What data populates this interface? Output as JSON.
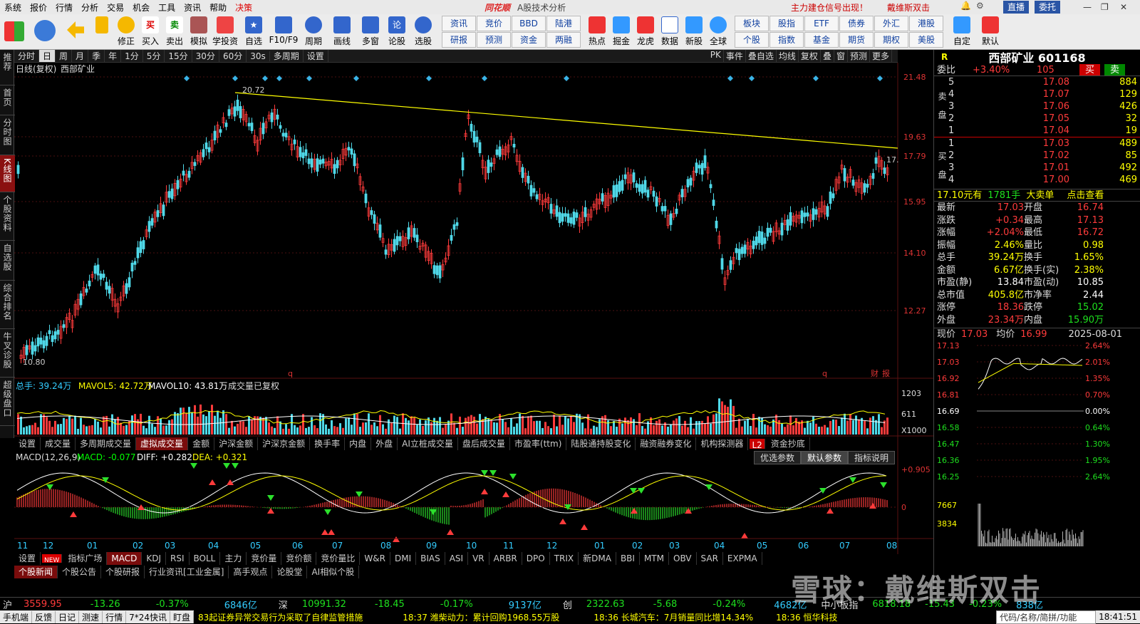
{
  "menu": {
    "items": [
      "系统",
      "报价",
      "行情",
      "分析",
      "交易",
      "机会",
      "工具",
      "资讯",
      "帮助",
      "决策"
    ],
    "brand": "同花顺",
    "subtitle": "A股技术分析",
    "notice1": "主力建仓信号出现！",
    "notice2": "戴维斯双击",
    "btn1": "直播",
    "btn2": "委托"
  },
  "toolbar": {
    "buttons": [
      "修正",
      "买入",
      "卖出",
      "模拟",
      "学投资",
      "自选",
      "F10/F9",
      "周期",
      "画线",
      "多窗",
      "论股",
      "选股"
    ],
    "grid1": [
      "资讯",
      "竞价",
      "BBD",
      "陆港",
      "研报",
      "预测",
      "资金",
      "两融"
    ],
    "buttons2": [
      "热点",
      "掘金",
      "龙虎",
      "数据",
      "新股",
      "全球"
    ],
    "grid2": [
      "板块",
      "股指",
      "ETF",
      "债券",
      "外汇",
      "港股",
      "个股",
      "指数",
      "基金",
      "期货",
      "期权",
      "美股"
    ],
    "buttons3": [
      "自定",
      "默认"
    ]
  },
  "leftnav": [
    "推荐",
    "首页",
    "分时图",
    "K线图",
    "个股资料",
    "自选股",
    "综合排名",
    "牛叉诊股",
    "超级盘口"
  ],
  "periods": [
    "分时",
    "日",
    "周",
    "月",
    "季",
    "年",
    "1分",
    "5分",
    "15分",
    "30分",
    "60分",
    "30s",
    "多周期",
    "设置"
  ],
  "period_selected": "日",
  "rightbar": [
    "PK",
    "事件",
    "叠自选",
    "均线",
    "复权",
    "叠",
    "窗",
    "预测",
    "更多"
  ],
  "kline": {
    "label": "日线(复权)",
    "stock": "西部矿业",
    "high_label": "20.72",
    "low_label": "10.80",
    "last_label": "17."
  },
  "price_ticks": [
    "21.48",
    "19.63",
    "17.79",
    "15.95",
    "14.10",
    "12.27"
  ],
  "volume": {
    "label_total": "总手: 39.24万",
    "label_mavol5": "MAVOL5: 42.72万",
    "label_mavol10": "MAVOL10: 43.81万",
    "label_note": "成交量已复权",
    "ticks": [
      "1203",
      "611",
      "X1000"
    ]
  },
  "vol_tabs": [
    "设置",
    "成交量",
    "多周期成交量",
    "虚拟成交量",
    "金额",
    "沪深金额",
    "沪深京金额",
    "换手率",
    "内盘",
    "外盘",
    "AI立桩成交量",
    "盘后成交量",
    "市盈率(ttm)",
    "陆股通持股变化",
    "融资融券变化",
    "机构探测器",
    "L2",
    "资金抄底"
  ],
  "macd": {
    "label": "MACD(12,26,9)",
    "macd": "MACD: -0.077",
    "diff": "DIFF: +0.282",
    "dea": "DEA: +0.321",
    "ticks": [
      "+0.905",
      "0"
    ],
    "buttons": [
      "优选参数",
      "默认参数",
      "指标说明"
    ]
  },
  "xaxis": [
    "11",
    "12",
    "01",
    "02",
    "03",
    "04",
    "05",
    "06",
    "07",
    "08",
    "09",
    "10",
    "11",
    "12",
    "01",
    "02",
    "03",
    "04",
    "05",
    "06",
    "07",
    "08"
  ],
  "ind_tabs": [
    "设置",
    "NEW",
    "指标广场",
    "MACD",
    "KDJ",
    "RSI",
    "BOLL",
    "主力",
    "竞价量",
    "竞价额",
    "竞价量比",
    "W&R",
    "DMI",
    "BIAS",
    "ASI",
    "VR",
    "ARBR",
    "DPO",
    "TRIX",
    "新DMA",
    "BBI",
    "MTM",
    "OBV",
    "SAR",
    "EXPMA"
  ],
  "news_tabs": [
    "个股新闻",
    "个股公告",
    "个股研报",
    "行业资讯[工业金属]",
    "高手观点",
    "论股堂",
    "AI相似个股"
  ],
  "quote": {
    "title": "西部矿业 601168",
    "r": "R",
    "weibi_label": "委比",
    "weibi": "+3.40%",
    "weicha": "105",
    "buy": "买",
    "sell": "卖",
    "sell_label": "卖盘",
    "buy_label": "买盘",
    "asks": [
      [
        "5",
        "17.08",
        "884"
      ],
      [
        "4",
        "17.07",
        "129"
      ],
      [
        "3",
        "17.06",
        "426"
      ],
      [
        "2",
        "17.05",
        "32"
      ],
      [
        "1",
        "17.04",
        "19"
      ]
    ],
    "bids": [
      [
        "1",
        "17.03",
        "489"
      ],
      [
        "2",
        "17.02",
        "85"
      ],
      [
        "3",
        "17.01",
        "492"
      ],
      [
        "4",
        "17.00",
        "469"
      ]
    ],
    "trade": "17.10元有",
    "trade_vol": "1781手",
    "trade_tag": "大卖单",
    "trade_more": "点击查看",
    "stats": [
      [
        "最新",
        "17.03",
        "开盘",
        "16.74"
      ],
      [
        "涨跌",
        "+0.34",
        "最高",
        "17.13"
      ],
      [
        "涨幅",
        "+2.04%",
        "最低",
        "16.72"
      ],
      [
        "振幅",
        "2.46%",
        "量比",
        "0.98"
      ],
      [
        "总手",
        "39.24万",
        "换手",
        "1.65%"
      ],
      [
        "金额",
        "6.67亿",
        "换手(实)",
        "2.38%"
      ],
      [
        "市盈(静)",
        "13.84",
        "市盈(动)",
        "10.85"
      ],
      [
        "总市值",
        "405.8亿",
        "市净率",
        "2.44"
      ],
      [
        "涨停",
        "18.36",
        "跌停",
        "15.02"
      ],
      [
        "外盘",
        "23.34万",
        "内盘",
        "15.90万"
      ]
    ],
    "now_label": "现价",
    "now": "17.03",
    "avg_label": "均价",
    "avg": "16.99",
    "date": "2025-08-01",
    "intraday_left": [
      "17.13",
      "17.03",
      "16.92",
      "16.81",
      "16.69",
      "16.58",
      "16.47",
      "16.36",
      "16.25"
    ],
    "intraday_right": [
      "2.64%",
      "2.01%",
      "1.35%",
      "0.70%",
      "0.00%",
      "0.64%",
      "1.30%",
      "1.95%",
      "2.64%"
    ],
    "vol_ticks": [
      "7667",
      "3834"
    ]
  },
  "status": {
    "sh_label": "沪",
    "sh": "3559.95",
    "sh_chg": "-13.26",
    "sh_pct": "-0.37%",
    "sh_amt": "6846亿",
    "sz_label": "深",
    "sz": "10991.32",
    "sz_chg": "-18.45",
    "sz_pct": "-0.17%",
    "sz_amt": "9137亿",
    "cy_label": "创",
    "cy": "2322.63",
    "cy_chg": "-5.68",
    "cy_pct": "-0.24%",
    "cy_amt": "4682亿",
    "zx_label": "中小板指",
    "zx": "6818.18",
    "zx_chg": "-15.43",
    "zx_pct": "-0.23%",
    "zx_amt": "838亿"
  },
  "bottom": {
    "items": [
      "手机端",
      "反馈",
      "日记",
      "测速",
      "行情",
      "7*24快讯",
      "盯盘"
    ],
    "news1": "83起证券异常交易行为采取了自律监管措施",
    "news2": "18:37 潍柴动力：累计回购1968.55万股",
    "news3": "18:36 长城汽车：7月销量同比增14.34%",
    "news4": "18:36 恒华科技",
    "search": "代码/名称/简拼/功能",
    "time": "18:41:51"
  },
  "watermark": "雪球：戴维斯双击"
}
